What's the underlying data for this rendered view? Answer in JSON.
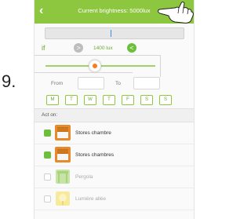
{
  "annotation": {
    "step_number": "9."
  },
  "header": {
    "title": "Current brightness: 5000lux"
  },
  "condition": {
    "if_label": "if",
    "less_label": ">",
    "threshold": "1400 lux",
    "more_label": "<",
    "slider_value_fraction": 0.45
  },
  "schedule": {
    "from_label": "From",
    "to_label": "To",
    "from_value": "",
    "to_value": "",
    "days": [
      "M",
      "T",
      "W",
      "T",
      "F",
      "S",
      "S"
    ]
  },
  "act_on": {
    "label": "Act on:",
    "devices": [
      {
        "name": "Stores chambre",
        "checked": true,
        "icon": "shutter-icon"
      },
      {
        "name": "Stores chambres",
        "checked": true,
        "icon": "shutter-icon"
      },
      {
        "name": "Pergola",
        "checked": false,
        "icon": "pergola-icon"
      },
      {
        "name": "Lumière allée",
        "checked": false,
        "icon": "lamp-icon"
      }
    ]
  },
  "colors": {
    "accent": "#8dc63f",
    "accent_dark": "#6cbf3a",
    "knob": "#ff7a1a",
    "shutter": "#e8892a",
    "pergola_disabled": "#c8e3a6",
    "lamp_disabled": "#f7ea9a"
  }
}
